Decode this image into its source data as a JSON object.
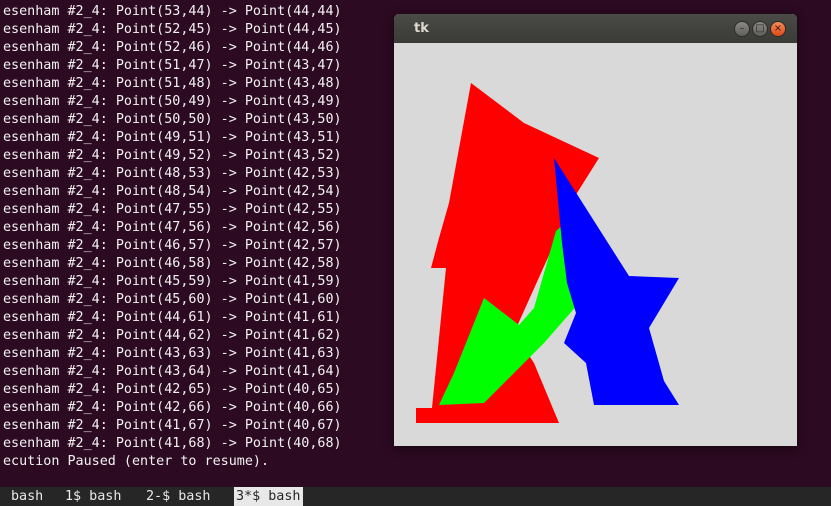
{
  "terminal": {
    "lines": [
      "esenham #2_4: Point(53,44) -> Point(44,44)",
      "esenham #2_4: Point(52,45) -> Point(44,45)",
      "esenham #2_4: Point(52,46) -> Point(44,46)",
      "esenham #2_4: Point(51,47) -> Point(43,47)",
      "esenham #2_4: Point(51,48) -> Point(43,48)",
      "esenham #2_4: Point(50,49) -> Point(43,49)",
      "esenham #2_4: Point(50,50) -> Point(43,50)",
      "esenham #2_4: Point(49,51) -> Point(43,51)",
      "esenham #2_4: Point(49,52) -> Point(43,52)",
      "esenham #2_4: Point(48,53) -> Point(42,53)",
      "esenham #2_4: Point(48,54) -> Point(42,54)",
      "esenham #2_4: Point(47,55) -> Point(42,55)",
      "esenham #2_4: Point(47,56) -> Point(42,56)",
      "esenham #2_4: Point(46,57) -> Point(42,57)",
      "esenham #2_4: Point(46,58) -> Point(42,58)",
      "esenham #2_4: Point(45,59) -> Point(41,59)",
      "esenham #2_4: Point(45,60) -> Point(41,60)",
      "esenham #2_4: Point(44,61) -> Point(41,61)",
      "esenham #2_4: Point(44,62) -> Point(41,62)",
      "esenham #2_4: Point(43,63) -> Point(41,63)",
      "esenham #2_4: Point(43,64) -> Point(41,64)",
      "esenham #2_4: Point(42,65) -> Point(40,65)",
      "esenham #2_4: Point(42,66) -> Point(40,66)",
      "esenham #2_4: Point(41,67) -> Point(40,67)",
      "esenham #2_4: Point(41,68) -> Point(40,68)",
      "ecution Paused (enter to resume)."
    ]
  },
  "statusbar": {
    "windows": [
      {
        "label": "bash",
        "active": false
      },
      {
        "label": "1$ bash",
        "active": false
      },
      {
        "label": "2-$ bash",
        "active": false
      },
      {
        "label": "3*$ bash",
        "active": true
      }
    ]
  },
  "tk_window": {
    "title": "tk",
    "buttons": {
      "minimize": "–",
      "maximize": "□",
      "close": "×"
    },
    "canvas_colors": {
      "background": "#d9d9d9",
      "red": "#ff0000",
      "green": "#00ff00",
      "blue": "#0000ff"
    }
  }
}
